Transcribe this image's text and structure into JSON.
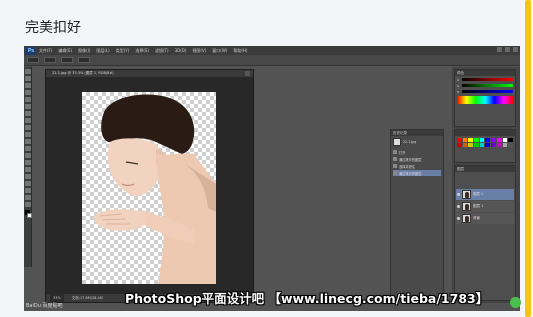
{
  "article": {
    "caption": "完美扣好"
  },
  "photoshop": {
    "app_logo": "Ps",
    "menu": [
      "文件(F)",
      "编辑(E)",
      "图像(I)",
      "图层(L)",
      "类型(Y)",
      "选择(S)",
      "滤镜(T)",
      "3D(D)",
      "视图(V)",
      "窗口(W)",
      "帮助(H)"
    ],
    "document_tab": "22-1.jpg @ 33.3% (图层 1, RGB/8#)",
    "status": {
      "zoom": "33%",
      "doc_info": "文档:17.6M/28.4M"
    },
    "history_panel": {
      "title": "历史记录",
      "snapshot": "22-1.jpg",
      "items": [
        "打开",
        "通过拷贝的图层",
        "选择并遮住",
        "通过拷贝的图层"
      ]
    },
    "color_panel": {
      "title": "颜色",
      "channels": [
        "R",
        "G",
        "B"
      ]
    },
    "layers_panel": {
      "title": "图层",
      "layers": [
        "图层 2",
        "图层 1",
        "背景"
      ]
    }
  },
  "watermark": {
    "text": "PhotoShop平面设计吧 【www.linecg.com/tieba/1783】"
  },
  "corner_logo": "BaiDu 百度贴吧",
  "colors": {
    "accent_scroll": "#f5c518",
    "ps_dark": "#535353",
    "selection": "#6a7fa5",
    "float_button": "#4bbf4b"
  }
}
